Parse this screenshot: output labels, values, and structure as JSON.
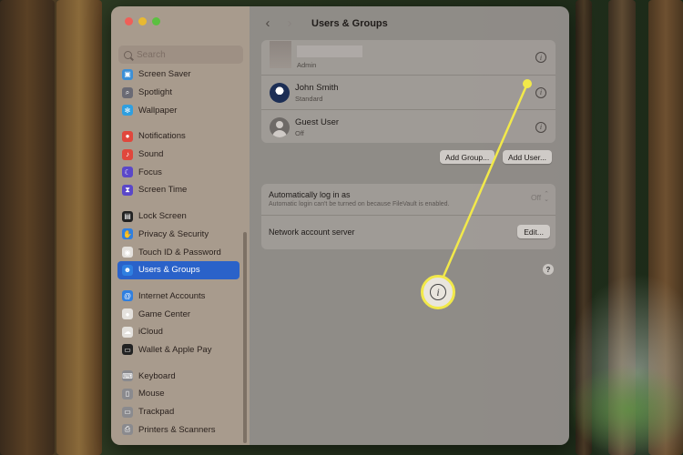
{
  "window": {
    "title": "Users & Groups",
    "nav_back": "‹",
    "nav_forward": "›"
  },
  "sidebar": {
    "search_placeholder": "Search",
    "groups": [
      [
        {
          "label": "Screen Saver",
          "icon": "screen-saver-icon",
          "color": "#3c8fd6"
        },
        {
          "label": "Spotlight",
          "icon": "spotlight-icon",
          "color": "#6a6a74"
        },
        {
          "label": "Wallpaper",
          "icon": "wallpaper-icon",
          "color": "#2f9fe0"
        }
      ],
      [
        {
          "label": "Notifications",
          "icon": "notifications-icon",
          "color": "#e0473c"
        },
        {
          "label": "Sound",
          "icon": "sound-icon",
          "color": "#e0473c"
        },
        {
          "label": "Focus",
          "icon": "focus-icon",
          "color": "#5a47c9"
        },
        {
          "label": "Screen Time",
          "icon": "screen-time-icon",
          "color": "#5a47c9"
        }
      ],
      [
        {
          "label": "Lock Screen",
          "icon": "lock-screen-icon",
          "color": "#222222"
        },
        {
          "label": "Privacy & Security",
          "icon": "privacy-icon",
          "color": "#2f7fe0"
        },
        {
          "label": "Touch ID & Password",
          "icon": "touch-id-icon",
          "color": "#e4e1dd"
        },
        {
          "label": "Users & Groups",
          "icon": "users-groups-icon",
          "color": "#2f7fe0",
          "active": true
        }
      ],
      [
        {
          "label": "Internet Accounts",
          "icon": "internet-accounts-icon",
          "color": "#2f7fe0"
        },
        {
          "label": "Game Center",
          "icon": "game-center-icon",
          "color": "#e4e1dd"
        },
        {
          "label": "iCloud",
          "icon": "icloud-icon",
          "color": "#e4e1dd"
        },
        {
          "label": "Wallet & Apple Pay",
          "icon": "wallet-icon",
          "color": "#222222"
        }
      ],
      [
        {
          "label": "Keyboard",
          "icon": "keyboard-icon",
          "color": "#8a8a8e"
        },
        {
          "label": "Mouse",
          "icon": "mouse-icon",
          "color": "#8a8a8e"
        },
        {
          "label": "Trackpad",
          "icon": "trackpad-icon",
          "color": "#8a8a8e"
        },
        {
          "label": "Printers & Scanners",
          "icon": "printers-icon",
          "color": "#8a8a8e"
        }
      ]
    ]
  },
  "users": [
    {
      "name": "",
      "role": "Admin",
      "avatar": "admin"
    },
    {
      "name": "John Smith",
      "role": "Standard",
      "avatar": "penguin"
    },
    {
      "name": "Guest User",
      "role": "Off",
      "avatar": "guest"
    }
  ],
  "info_glyph": "i",
  "buttons": {
    "add_group": "Add Group...",
    "add_user": "Add User..."
  },
  "login_settings": {
    "auto_login_label": "Automatically log in as",
    "auto_login_value": "Off",
    "auto_login_note": "Automatic login can't be turned on because FileVault is enabled.",
    "network_label": "Network account server",
    "edit_button": "Edit..."
  },
  "help_label": "?",
  "callout": {
    "color": "#f2e94a",
    "icon": "info-icon"
  }
}
